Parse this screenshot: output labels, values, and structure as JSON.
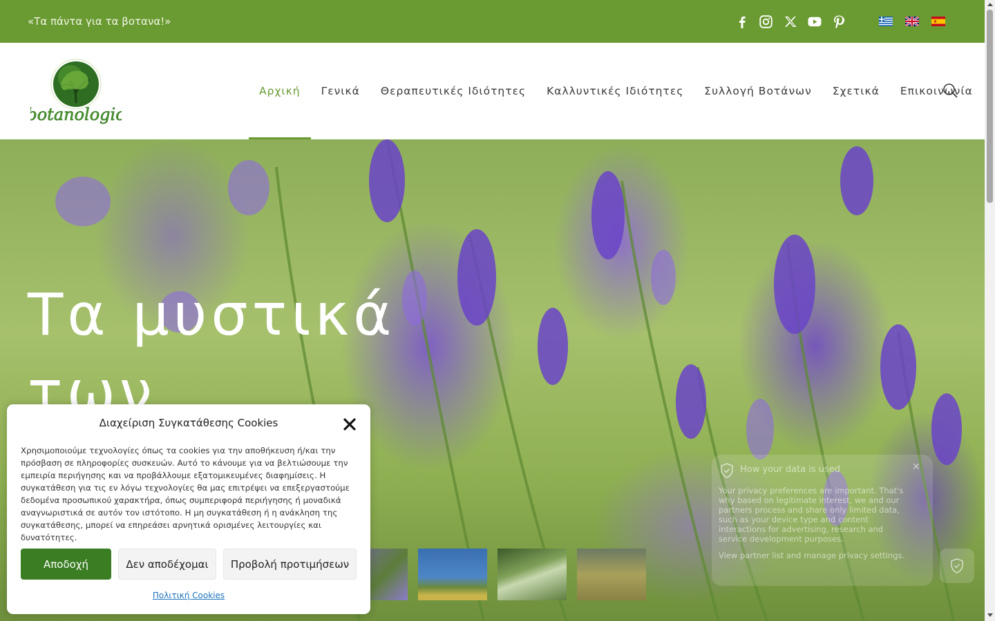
{
  "topbar": {
    "tagline": "«Τα πάντα για τα βοτανα!»",
    "social": [
      "facebook-icon",
      "instagram-icon",
      "x-icon",
      "youtube-icon",
      "pinterest-icon"
    ],
    "languages": [
      "Ελληνικά",
      "English",
      "Español"
    ],
    "background_color": "#6a9a32"
  },
  "logo": {
    "text": "botanologio"
  },
  "nav": {
    "items": [
      {
        "label": "Αρχική",
        "active": true
      },
      {
        "label": "Γενικά"
      },
      {
        "label": "Θεραπευτικές Ιδιότητες"
      },
      {
        "label": "Καλλυντικές Ιδιότητες"
      },
      {
        "label": "Συλλογή Βοτάνων"
      },
      {
        "label": "Σχετικά"
      },
      {
        "label": "Επικοινωνία"
      }
    ],
    "accent_color": "#6a9a32"
  },
  "hero": {
    "title_line1": "Τα μυστικά",
    "title_line2": "των"
  },
  "cookie": {
    "title": "Διαχείριση Συγκατάθεσης Cookies",
    "text": "Χρησιμοποιούμε τεχνολογίες όπως τα cookies για την αποθήκευση ή/και την πρόσβαση σε πληροφορίες συσκευών. Αυτό το κάνουμε για να βελτιώσουμε την εμπειρία περιήγησης και να προβάλλουμε εξατομικευμένες διαφημίσεις. Η συγκατάθεση για τις εν λόγω τεχνολογίες θα μας επιτρέψει να επεξεργαστούμε δεδομένα προσωπικού χαρακτήρα, όπως συμπεριφορά περιήγησης ή μοναδικά αναγνωριστικά σε αυτόν τον ιστότοπο. Η μη συγκατάθεση ή η ανάκληση της συγκατάθεσης, μπορεί να επηρεάσει αρνητικά ορισμένες λειτουργίες και δυνατότητες.",
    "accept": "Αποδοχή",
    "deny": "Δεν αποδέχομαι",
    "preferences": "Προβολή προτιμήσεων",
    "policy_link": "Πολιτική Cookies",
    "accept_color": "#3a7d22"
  },
  "privacy": {
    "title": "How your data is used",
    "text": "Your privacy preferences are important. That's why based on legitimate interest, we and our partners process and share only limited data, such as your device type and content interactions for advertising, research and service development purposes.",
    "link1": "View partner list",
    "mid": " and manage ",
    "link2": "privacy settings",
    "end": "."
  }
}
